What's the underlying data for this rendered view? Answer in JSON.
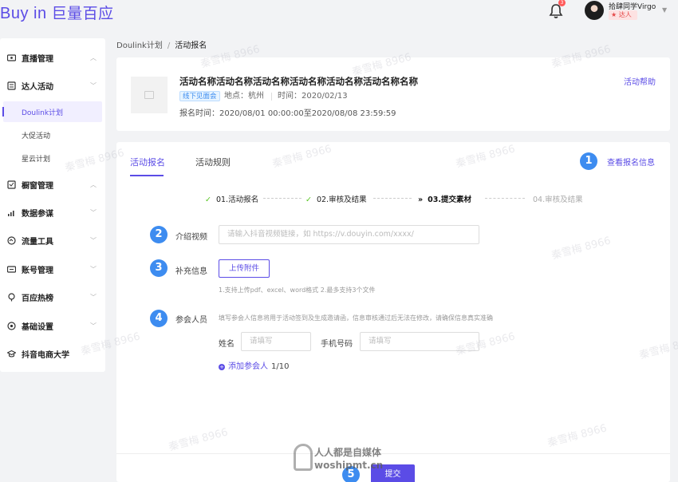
{
  "header": {
    "logo_en": "Buy in",
    "logo_cn": "巨量百应",
    "notification_count": "3",
    "user_name": "拾肆同学Virgo",
    "user_tag": "达人"
  },
  "sidebar": {
    "items": [
      {
        "label": "直播管理",
        "icon": "live-icon"
      },
      {
        "label": "达人活动",
        "icon": "activity-icon"
      },
      {
        "label": "Doulink计划",
        "icon": ""
      },
      {
        "label": "大促活动",
        "icon": ""
      },
      {
        "label": "星云计划",
        "icon": ""
      },
      {
        "label": "橱窗管理",
        "icon": "showcase-icon"
      },
      {
        "label": "数据参谋",
        "icon": "chart-icon"
      },
      {
        "label": "流量工具",
        "icon": "traffic-icon"
      },
      {
        "label": "账号管理",
        "icon": "account-icon"
      },
      {
        "label": "百应热榜",
        "icon": "hot-icon"
      },
      {
        "label": "基础设置",
        "icon": "gear-icon"
      },
      {
        "label": "抖音电商大学",
        "icon": "graduation-icon"
      }
    ]
  },
  "breadcrumb": {
    "parent": "Doulink计划",
    "separator": "/",
    "current": "活动报名"
  },
  "activity": {
    "title": "活动名称活动名称活动名称活动名称活动名称活动名称名称",
    "tag": "线下见面会",
    "location": "地点：杭州",
    "time": "时间：2020/02/13",
    "signup_period": "报名时间：2020/08/01 00:00:00至2020/08/08 23:59:59",
    "help_link": "活动帮助"
  },
  "tabs": {
    "signup": "活动报名",
    "rules": "活动规则",
    "view_info": "查看报名信息"
  },
  "steps": [
    {
      "label": "01.活动报名",
      "state": "done"
    },
    {
      "label": "02.审核及结果",
      "state": "done"
    },
    {
      "label": "03.提交素材",
      "state": "current"
    },
    {
      "label": "04.审核及结果",
      "state": "todo"
    }
  ],
  "form": {
    "video_label": "介绍视频",
    "video_placeholder": "请输入抖音视频链接，如 https://v.douyin.com/xxxx/",
    "supplement_label": "补充信息",
    "upload_button": "上传附件",
    "upload_hint": "1.支持上传pdf、excel、word格式  2.最多支持3个文件",
    "participant_label": "参会人员",
    "participant_hint": "填写参会人信息将用于活动签到及生成邀请函，信息审核通过后无法在修改，请确保信息真实准确",
    "name_label": "姓名",
    "name_placeholder": "请填写",
    "phone_label": "手机号码",
    "phone_placeholder": "请填写",
    "add_person": "添加参会人",
    "add_count": "1/10",
    "submit": "提交"
  },
  "badges": [
    "1",
    "2",
    "3",
    "4",
    "5"
  ],
  "watermark": {
    "text": "秦雪梅 8966",
    "site_cn": "人人都是自媒体",
    "site_en": "woshipmt.cn"
  },
  "colors": {
    "brand": "#5b4ce6",
    "badge": "#3d8cf0",
    "success": "#52c41a"
  }
}
